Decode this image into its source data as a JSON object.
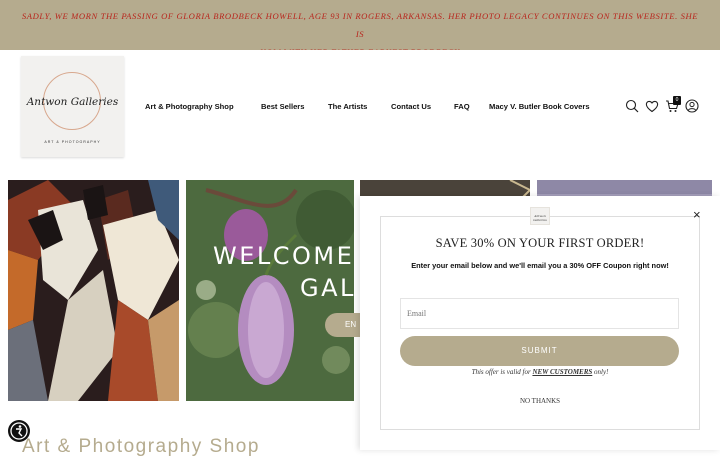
{
  "announcement": {
    "line1": "SADLY, WE MORN THE PASSING OF GLORIA BRODBECK HOWELL, AGE 93 IN ROGERS, ARKANSAS. HER PHOTO LEGACY CONTINUES ON THIS WEBSITE. SHE IS",
    "line2": "NOW WITH HER FATHER EARNEST BRODBECK",
    "text_color": "#b8261d",
    "background": "#b5ab8e"
  },
  "logo": {
    "name": "Antwon Galleries",
    "subtitle": "ART & PHOTOGRAPHY"
  },
  "nav": {
    "items": [
      {
        "label": "Art & Photography Shop"
      },
      {
        "label": "Best Sellers"
      },
      {
        "label": "The Artists"
      },
      {
        "label": "Contact Us"
      },
      {
        "label": "FAQ"
      },
      {
        "label": "Macy V. Butler Book Covers"
      }
    ],
    "cart_count": "0"
  },
  "hero": {
    "welcome_line1": "WELCOME",
    "welcome_line2": "GAL",
    "enter_label": "EN"
  },
  "section": {
    "title": "Art & Photography Shop"
  },
  "popup": {
    "mini_logo": "Antwon Galleries",
    "title": "SAVE 30% ON YOUR FIRST ORDER!",
    "description": "Enter your email below and we'll email you a 30% OFF Coupon right now!",
    "email_placeholder": "Email",
    "submit_label": "SUBMIT",
    "offer_prefix": "This offer is valid for",
    "offer_link": "NEW CUSTOMERS",
    "offer_suffix": "only!",
    "no_thanks_label": "NO THANKS",
    "close_label": "×"
  },
  "icons": [
    "search-icon",
    "heart-icon",
    "cart-icon",
    "user-icon",
    "accessibility-icon",
    "close-icon"
  ],
  "colors": {
    "accent": "#b5ab8e",
    "announcement_text": "#b8261d"
  }
}
